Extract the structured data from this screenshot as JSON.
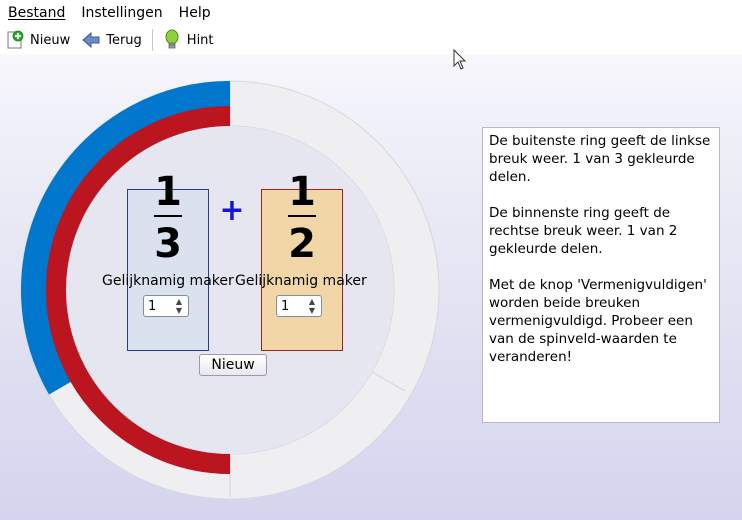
{
  "menu": {
    "items": [
      {
        "label": "Bestand"
      },
      {
        "label": "Instellingen"
      },
      {
        "label": "Help"
      }
    ]
  },
  "toolbar": {
    "new_label": "Nieuw",
    "back_label": "Terug",
    "hint_label": "Hint"
  },
  "left_fraction": {
    "numerator": "1",
    "denominator": "3",
    "maker_label": "Gelijknamig maker",
    "spin_value": "1",
    "ring_color": "#0077cc",
    "box_color": "#d9e2ee"
  },
  "right_fraction": {
    "numerator": "1",
    "denominator": "2",
    "maker_label": "Gelijknamig maker",
    "spin_value": "1",
    "ring_color": "#bb1520",
    "box_color": "#f1d7a8"
  },
  "operator": "+",
  "new_button_label": "Nieuw",
  "info_text": "De buitenste ring geeft de linkse breuk weer. 1 van 3 gekleurde delen.\n\nDe binnenste ring geeft de rechtse breuk weer. 1 van 2 gekleurde delen.\n\nMet de knop 'Vermenigvuldigen' worden beide breuken vermenigvuldigd. Probeer een van de spinveld-waarden te veranderen!"
}
